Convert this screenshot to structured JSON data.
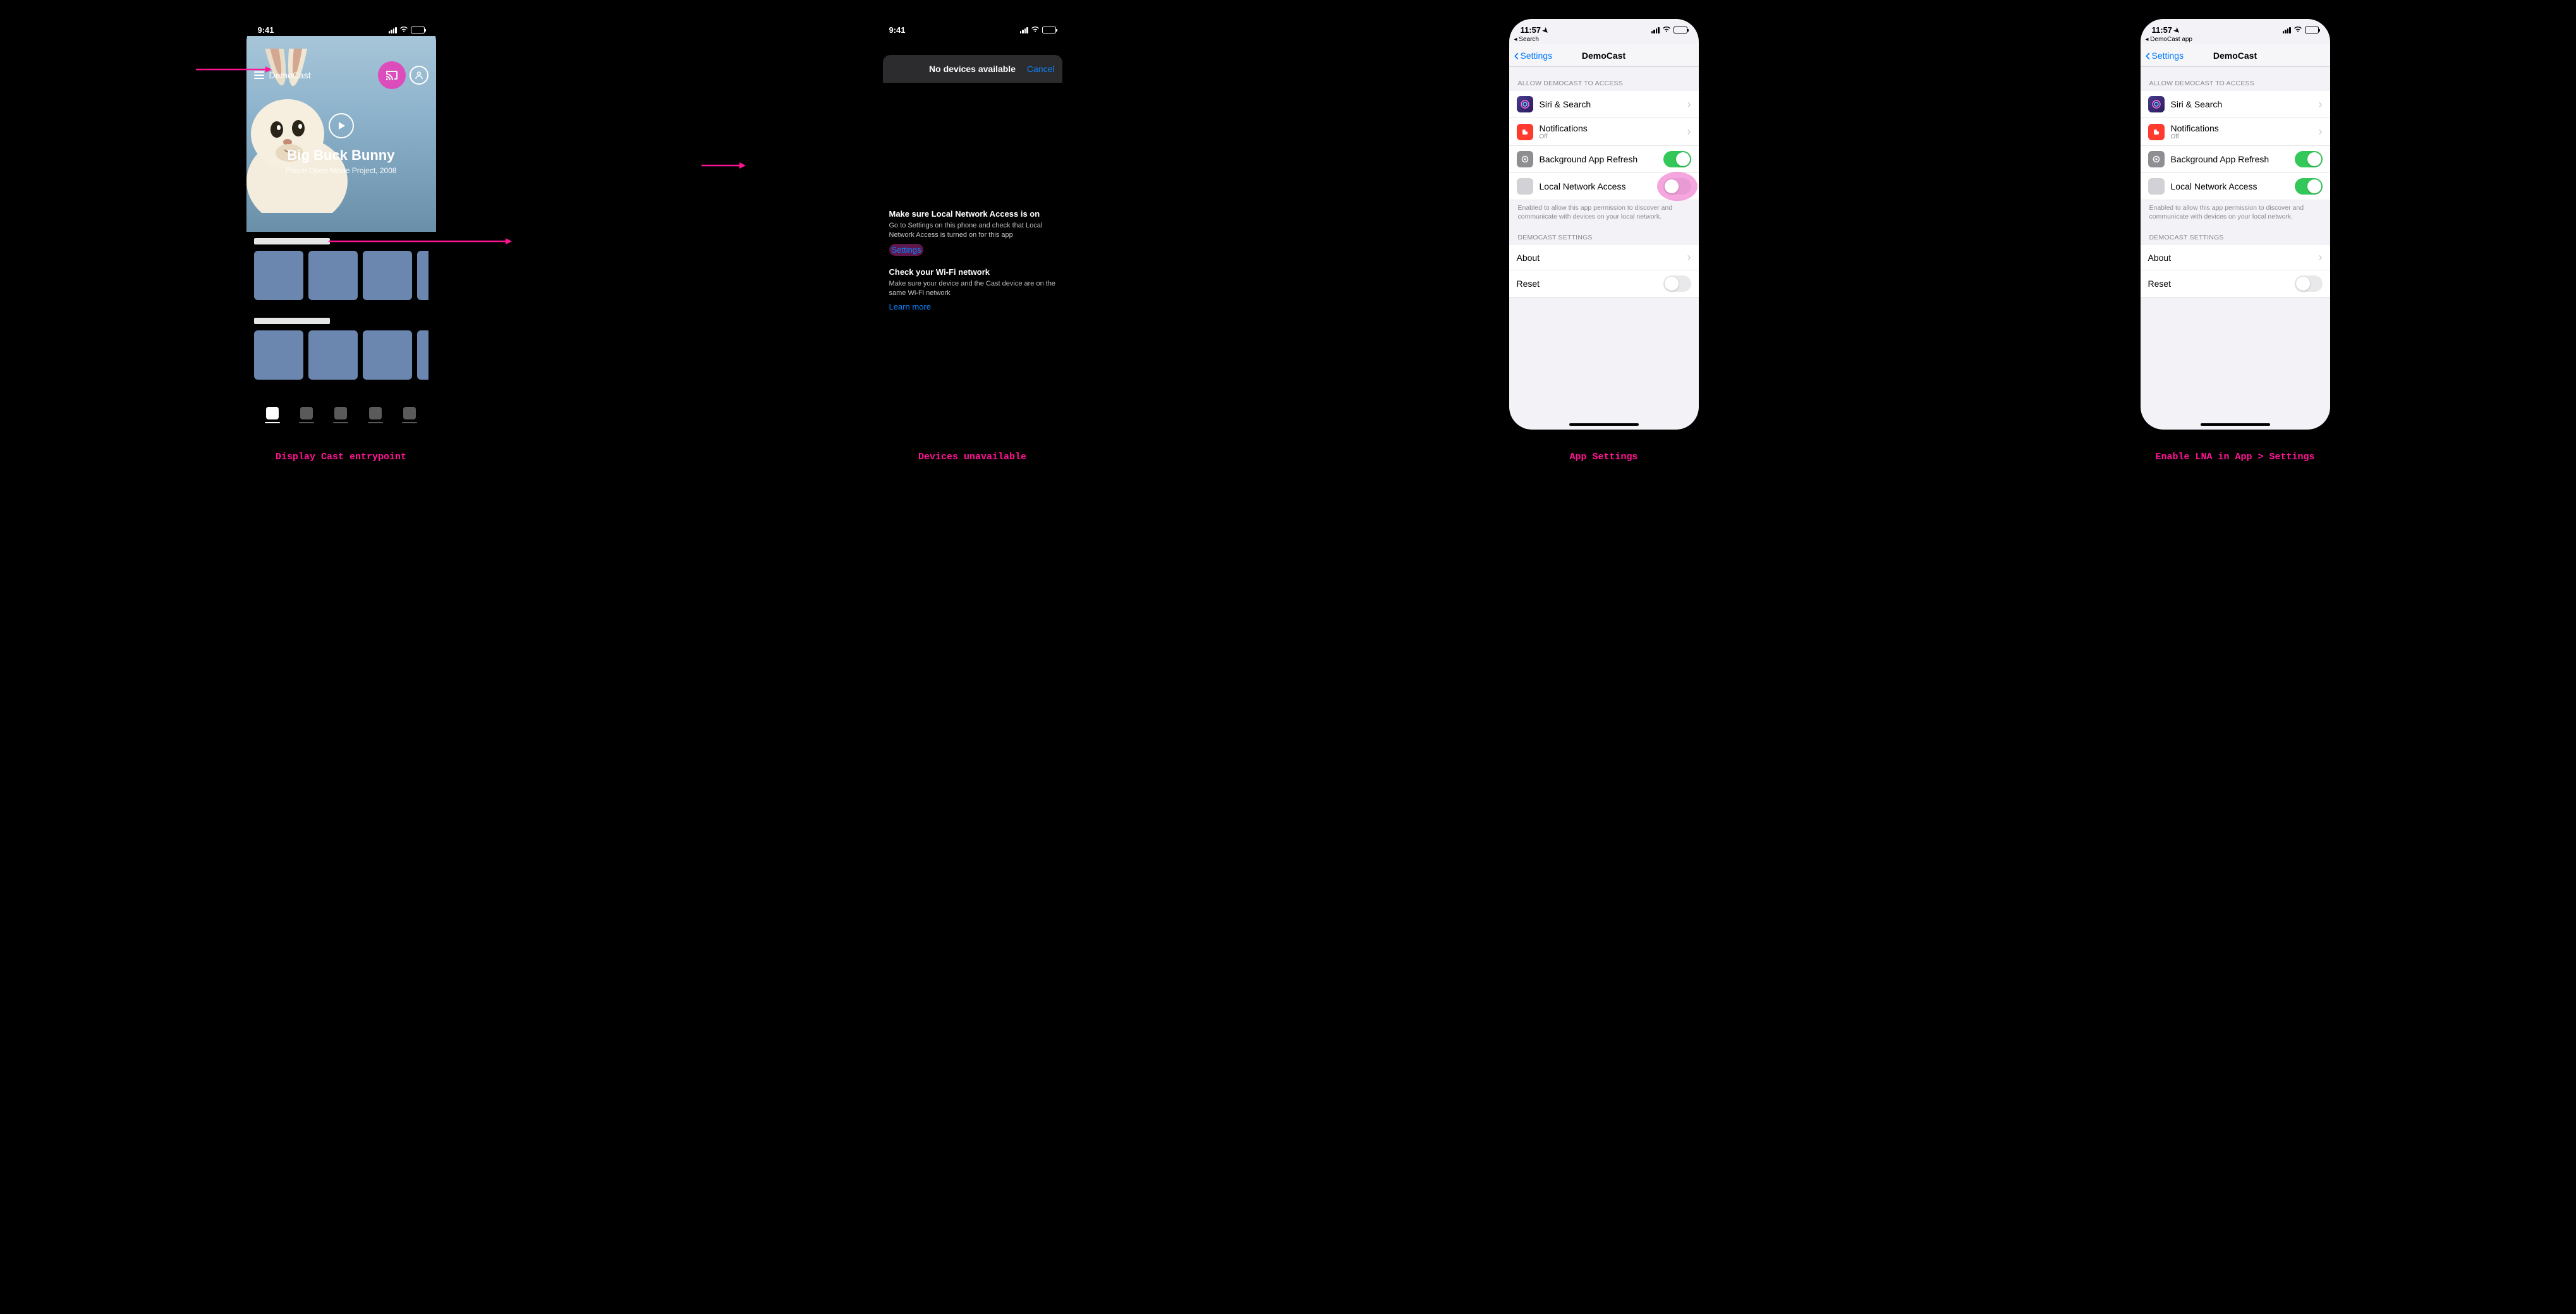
{
  "captions": {
    "p1": "Display Cast entrypoint",
    "p2": "Devices unavailable",
    "p3": "App Settings",
    "p4": "Enable LNA in App > Settings"
  },
  "status": {
    "time_dark": "9:41",
    "time_light": "11:57"
  },
  "breadcrumb": {
    "p3": "◂ Search",
    "p4": "◂ DemoCast app"
  },
  "phone1": {
    "app_title": "DemoCast",
    "hero_title": "Big Buck Bunny",
    "hero_sub": "Peach Open Movie Project, 2008"
  },
  "phone2": {
    "sheet_title": "No devices available",
    "cancel": "Cancel",
    "b1_h": "Make sure Local Network Access is on",
    "b1_p": "Go to Settings on this phone and check that Local Network Access is turned on for this app",
    "b1_link": "Settings",
    "b2_h": "Check your Wi-Fi network",
    "b2_p": "Make sure your device and the Cast device are on the same Wi-Fi network",
    "b2_link": "Learn more"
  },
  "settings": {
    "nav_back": "Settings",
    "nav_title": "DemoCast",
    "section1": "Allow DemoCast to Access",
    "siri": "Siri & Search",
    "notif": "Notifications",
    "notif_sub": "Off",
    "bgrefresh": "Background App Refresh",
    "lna": "Local Network Access",
    "lna_note": "Enabled to allow this app permission to discover and communicate with devices on your local network.",
    "section2": "DemoCast Settings",
    "about": "About",
    "reset": "Reset"
  }
}
